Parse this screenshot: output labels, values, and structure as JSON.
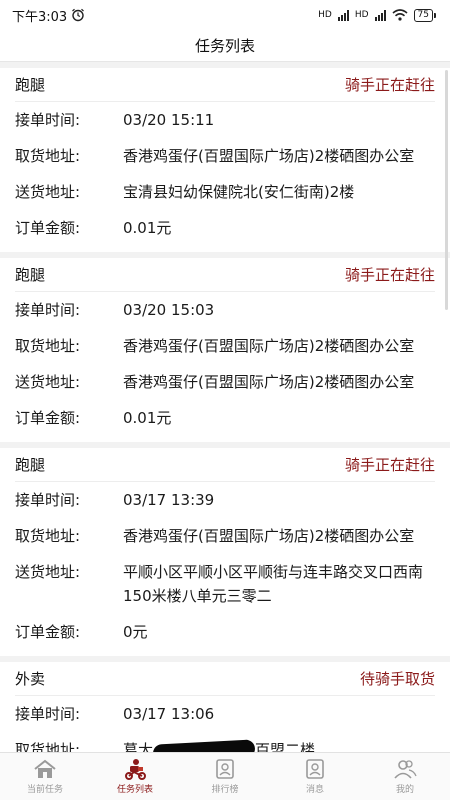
{
  "status_bar": {
    "time": "下午3:03",
    "battery": "75",
    "network_1": "HD",
    "network_2": "HD"
  },
  "header": {
    "title": "任务列表"
  },
  "labels": {
    "accept_time": "接单时间:",
    "pickup": "取货地址:",
    "delivery": "送货地址:",
    "amount": "订单金额:"
  },
  "orders": [
    {
      "type": "跑腿",
      "status": "骑手正在赶往",
      "accept_time": "03/20 15:11",
      "pickup": "香港鸡蛋仔(百盟国际广场店)2楼硒图办公室",
      "delivery": "宝清县妇幼保健院北(安仁街南)2楼",
      "amount": "0.01元"
    },
    {
      "type": "跑腿",
      "status": "骑手正在赶往",
      "accept_time": "03/20 15:03",
      "pickup": "香港鸡蛋仔(百盟国际广场店)2楼硒图办公室",
      "delivery": "香港鸡蛋仔(百盟国际广场店)2楼硒图办公室",
      "amount": "0.01元"
    },
    {
      "type": "跑腿",
      "status": "骑手正在赶往",
      "accept_time": "03/17 13:39",
      "pickup": "香港鸡蛋仔(百盟国际广场店)2楼硒图办公室",
      "delivery": "平顺小区平顺小区平顺街与连丰路交叉口西南150米楼八单元三零二",
      "amount": "0元"
    },
    {
      "type": "外卖",
      "status": "待骑手取货",
      "accept_time": "03/17 13:06",
      "pickup_prefix": "葛大",
      "pickup_suffix": "百盟二楼"
    }
  ],
  "tabbar": {
    "items": [
      {
        "label": "当前任务",
        "icon": "home-icon"
      },
      {
        "label": "任务列表",
        "icon": "rider-icon"
      },
      {
        "label": "排行榜",
        "icon": "rank-icon"
      },
      {
        "label": "消息",
        "icon": "message-icon"
      },
      {
        "label": "我的",
        "icon": "profile-icon"
      }
    ],
    "active_index": 1
  },
  "colors": {
    "accent": "#8b1a1a",
    "inactive": "#9a9a9a",
    "background": "#f2f2f2"
  }
}
